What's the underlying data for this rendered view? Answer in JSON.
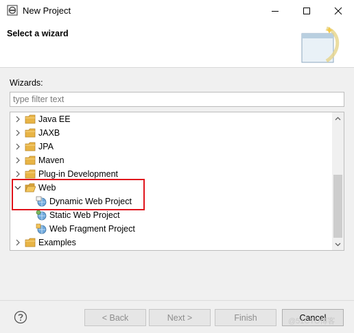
{
  "window": {
    "title": "New Project"
  },
  "banner": {
    "title": "Select a wizard"
  },
  "wizards": {
    "label": "Wizards:",
    "filter_placeholder": "type filter text"
  },
  "tree": {
    "items": [
      {
        "label": "Java EE",
        "type": "folder",
        "expanded": false
      },
      {
        "label": "JAXB",
        "type": "folder",
        "expanded": false
      },
      {
        "label": "JPA",
        "type": "folder",
        "expanded": false
      },
      {
        "label": "Maven",
        "type": "folder",
        "expanded": false
      },
      {
        "label": "Plug-in Development",
        "type": "folder",
        "expanded": false
      },
      {
        "label": "Web",
        "type": "folder",
        "expanded": true
      },
      {
        "label": "Dynamic Web Project",
        "type": "project",
        "icon": "dynamic-web-project-icon"
      },
      {
        "label": "Static Web Project",
        "type": "project",
        "icon": "static-web-project-icon"
      },
      {
        "label": "Web Fragment Project",
        "type": "project",
        "icon": "web-fragment-project-icon"
      },
      {
        "label": "Examples",
        "type": "folder",
        "expanded": false
      }
    ]
  },
  "buttons": {
    "back": "< Back",
    "next": "Next >",
    "finish": "Finish",
    "cancel": "Cancel"
  },
  "watermark": "@51CTO博客",
  "colors": {
    "highlight_border": "#e0131b",
    "folder": "#e8b445"
  }
}
